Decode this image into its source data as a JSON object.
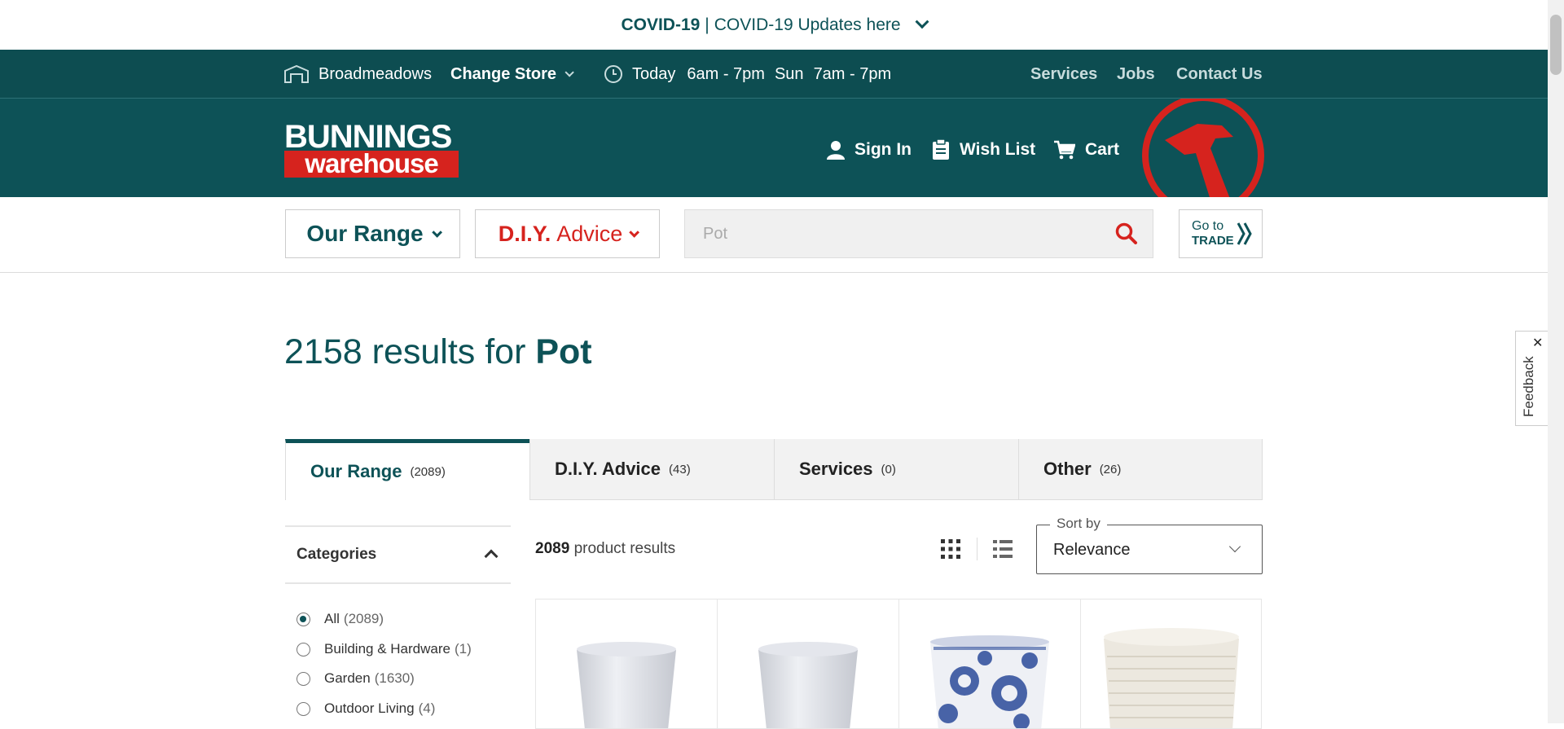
{
  "covid": {
    "bold": "COVID-19",
    "link": "COVID-19 Updates here"
  },
  "storebar": {
    "store": "Broadmeadows",
    "change_store": "Change Store",
    "hours_today_label": "Today",
    "hours_today": "6am - 7pm",
    "hours_sun_label": "Sun",
    "hours_sun": "7am - 7pm",
    "links": [
      "Services",
      "Jobs",
      "Contact Us"
    ]
  },
  "header": {
    "logo_top": "BUNNINGS",
    "logo_bottom": "warehouse",
    "sign_in": "Sign In",
    "wish_list": "Wish List",
    "cart": "Cart"
  },
  "nav": {
    "our_range": "Our Range",
    "diy_bold": "D.I.Y.",
    "diy_rest": "Advice",
    "search_value": "Pot",
    "search_placeholder": "Pot",
    "trade_top": "Go to",
    "trade_bottom": "TRADE"
  },
  "results": {
    "count": "2158",
    "mid": "results for",
    "query": "Pot"
  },
  "tabs": [
    {
      "label": "Our Range",
      "count": "(2089)"
    },
    {
      "label": "D.I.Y. Advice",
      "count": "(43)"
    },
    {
      "label": "Services",
      "count": "(0)"
    },
    {
      "label": "Other",
      "count": "(26)"
    }
  ],
  "categories": {
    "title": "Categories",
    "items": [
      {
        "label": "All",
        "count": "(2089)",
        "selected": true
      },
      {
        "label": "Building & Hardware",
        "count": "(1)",
        "selected": false
      },
      {
        "label": "Garden",
        "count": "(1630)",
        "selected": false
      },
      {
        "label": "Outdoor Living",
        "count": "(4)",
        "selected": false
      }
    ]
  },
  "product_results": {
    "count": "2089",
    "label": "product results"
  },
  "sort": {
    "label": "Sort by",
    "value": "Relevance"
  },
  "feedback": {
    "label": "Feedback",
    "close": "✕"
  },
  "colors": {
    "brand_teal": "#0d5257",
    "brand_red": "#d6231e"
  },
  "icons": [
    "store-icon",
    "clock-icon",
    "user-icon",
    "wishlist-icon",
    "cart-icon",
    "search-icon",
    "grid-view-icon",
    "list-view-icon"
  ]
}
